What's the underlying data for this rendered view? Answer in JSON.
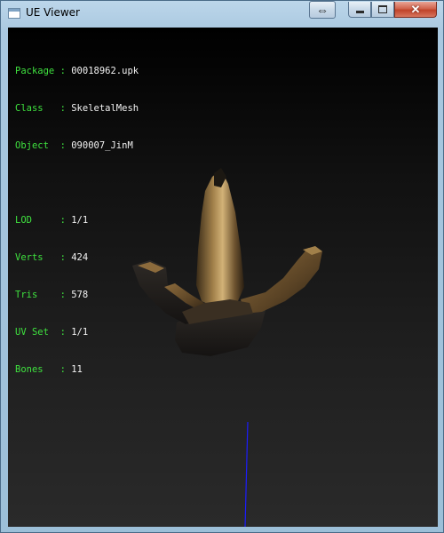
{
  "window": {
    "title": "UE Viewer",
    "controls": {
      "swap_icon": "double-arrow-icon",
      "minimize_icon": "minimize-icon",
      "maximize_icon": "maximize-icon",
      "close_icon": "close-icon"
    }
  },
  "info_panel": {
    "asset": [
      {
        "key": "Package",
        "sep": " : ",
        "value": "00018962.upk"
      },
      {
        "key": "Class  ",
        "sep": " : ",
        "value": "SkeletalMesh"
      },
      {
        "key": "Object ",
        "sep": " : ",
        "value": "090007_JinM"
      }
    ],
    "stats": [
      {
        "key": "LOD    ",
        "sep": " : ",
        "value": "1/1"
      },
      {
        "key": "Verts  ",
        "sep": " : ",
        "value": "424"
      },
      {
        "key": "Tris   ",
        "sep": " : ",
        "value": "578"
      },
      {
        "key": "UV Set ",
        "sep": " : ",
        "value": "1/1"
      },
      {
        "key": "Bones  ",
        "sep": " : ",
        "value": "11"
      }
    ]
  },
  "colors": {
    "label_green": "#3fe23f",
    "value_white": "#f2f2f2",
    "axis_blue": "#1c1cff",
    "mesh_gold": "#8a6a3a"
  }
}
